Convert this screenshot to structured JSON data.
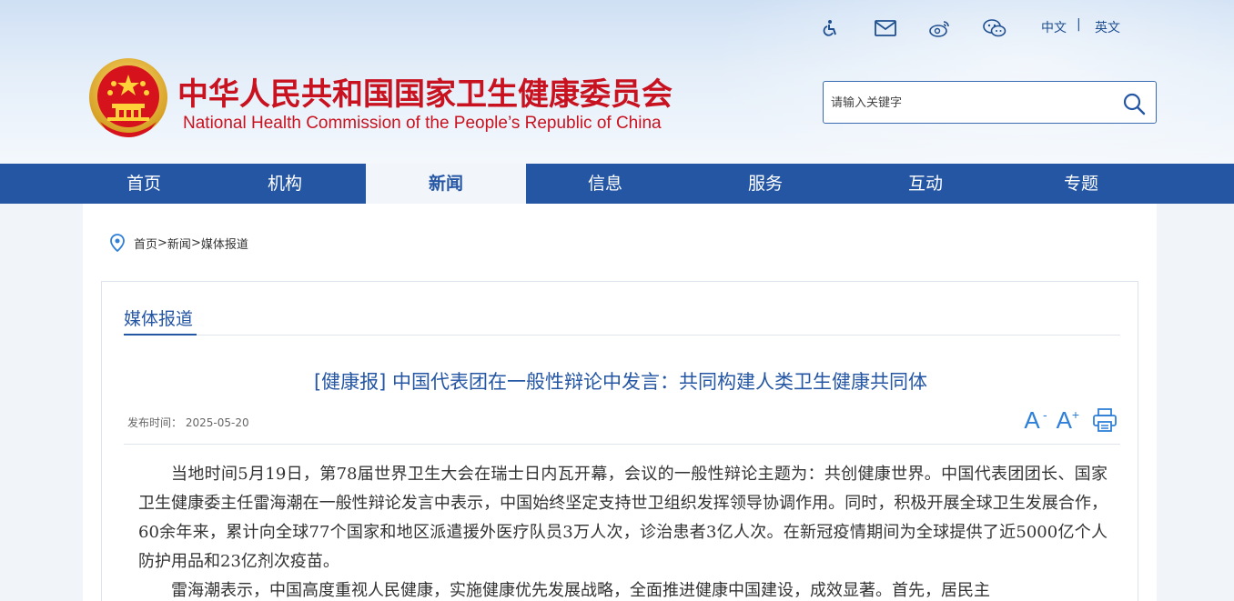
{
  "header": {
    "title": "中华人民共和国国家卫生健康委员会",
    "subtitle": "National Health Commission of the People’s  Republic of China",
    "icons": [
      "accessibility-icon",
      "mail-icon",
      "weibo-icon",
      "wechat-icon"
    ],
    "lang_cn": "中文",
    "lang_sep": "|",
    "lang_en": "英文",
    "search_placeholder": "请输入关键字",
    "brand_color": "#c8121f",
    "accent_color": "#2456a4"
  },
  "nav": {
    "items": [
      "首页",
      "机构",
      "新闻",
      "信息",
      "服务",
      "互动",
      "专题"
    ],
    "active": "新闻"
  },
  "breadcrumb": {
    "home": "首页",
    "sep1": ">",
    "news": "新闻",
    "sep2": ">",
    "current": "媒体报道"
  },
  "section": {
    "title": "媒体报道"
  },
  "article": {
    "title": "[健康报] 中国代表团在一般性辩论中发言：共同构建人类卫生健康共同体",
    "pubdate_label": "发布时间：",
    "pubdate": "2025-05-20",
    "font_decrease": "A",
    "font_decrease_mark": "-",
    "font_increase": "A",
    "font_increase_mark": "+",
    "paragraphs": [
      "当地时间5月19日，第78届世界卫生大会在瑞士日内瓦开幕，会议的一般性辩论主题为：共创健康世界。中国代表团团长、国家卫生健康委主任雷海潮在一般性辩论发言中表示，中国始终坚定支持世卫组织发挥领导协调作用。同时，积极开展全球卫生发展合作，60余年来，累计向全球77个国家和地区派遣援外医疗队员3万人次，诊治患者3亿人次。在新冠疫情期间为全球提供了近5000亿个人防护用品和23亿剂次疫苗。",
      "雷海潮表示，中国高度重视人民健康，实施健康优先发展战略，全面推进健康中国建设，成效显著。首先，居民主"
    ]
  }
}
